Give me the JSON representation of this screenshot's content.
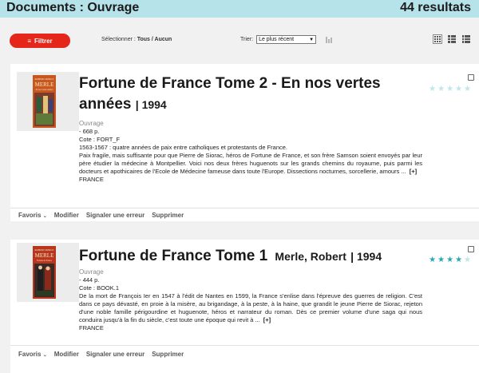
{
  "header": {
    "title": "Documents : Ouvrage",
    "count": "44 resultats"
  },
  "toolbar": {
    "filter_label": "Filtrer",
    "select_prefix": "Sélectionner : ",
    "select_all": "Tous",
    "select_sep": " / ",
    "select_none": "Aucun",
    "sort_label": "Trier:",
    "sort_value": "Le plus récent"
  },
  "colors": {
    "accent_red": "#e5261a",
    "header_bg": "#b6e2e9",
    "star_teal": "#26a9b5",
    "star_empty": "#bfe6ea"
  },
  "records": [
    {
      "title": "Fortune de France Tome 2 - En nos vertes années",
      "author": "",
      "year": "| 1994",
      "type": "Ouvrage",
      "pages": "- 668 p.",
      "cote": "Cote : FORT_F",
      "summary1": "1563-1567 : quatre années de paix entre catholiques et protestants de France.",
      "summary2": "Paix fragile, mais suffisante pour que Pierre de Siorac, héros de Fortune de France, et son frère Samson soient envoyés par leur père étudier la médecine à Montpellier. Voici nos deux frères huguenots sur les grands chemins du royaume, puis parmi les docteurs et apothicaires de l'Ecole de Médecine fameuse dans toute l'Europe. Dissections nocturnes, sorcellerie, amours ...",
      "more": "[+]",
      "country": "FRANCE",
      "rating": 0,
      "cover_author": "ROBERT MERLE",
      "cover_title": "En nos vertes années"
    },
    {
      "title": "Fortune de France Tome 1",
      "author": "Merle, Robert",
      "year": "| 1994",
      "type": "Ouvrage",
      "pages": "- 444 p.",
      "cote": "Cote : BOOK.1",
      "summary1": "",
      "summary2": "De la mort de François Ier en 1547 à l'édit de Nantes en 1599, la France s'enlise dans l'épreuve des guerres de religion. C'est dans ce pays dévasté, en proie à la misère, au brigandage, à la peste, à la haine, que grandit le jeune Pierre de Siorac, rejeton d'une noble famille périgourdine et huguenote, héros et narrateur du roman. Dès ce premier volume d'une saga qui nous conduira jusqu'à la fin du siècle, c'est toute une époque qui revit à ...",
      "more": "[+]",
      "country": "FRANCE",
      "rating": 4,
      "cover_author": "ROBERT MERLE",
      "cover_title": "Fortune de France"
    }
  ],
  "actions": {
    "favoris": "Favoris",
    "modifier": "Modifier",
    "signaler": "Signaler une erreur",
    "supprimer": "Supprimer"
  }
}
